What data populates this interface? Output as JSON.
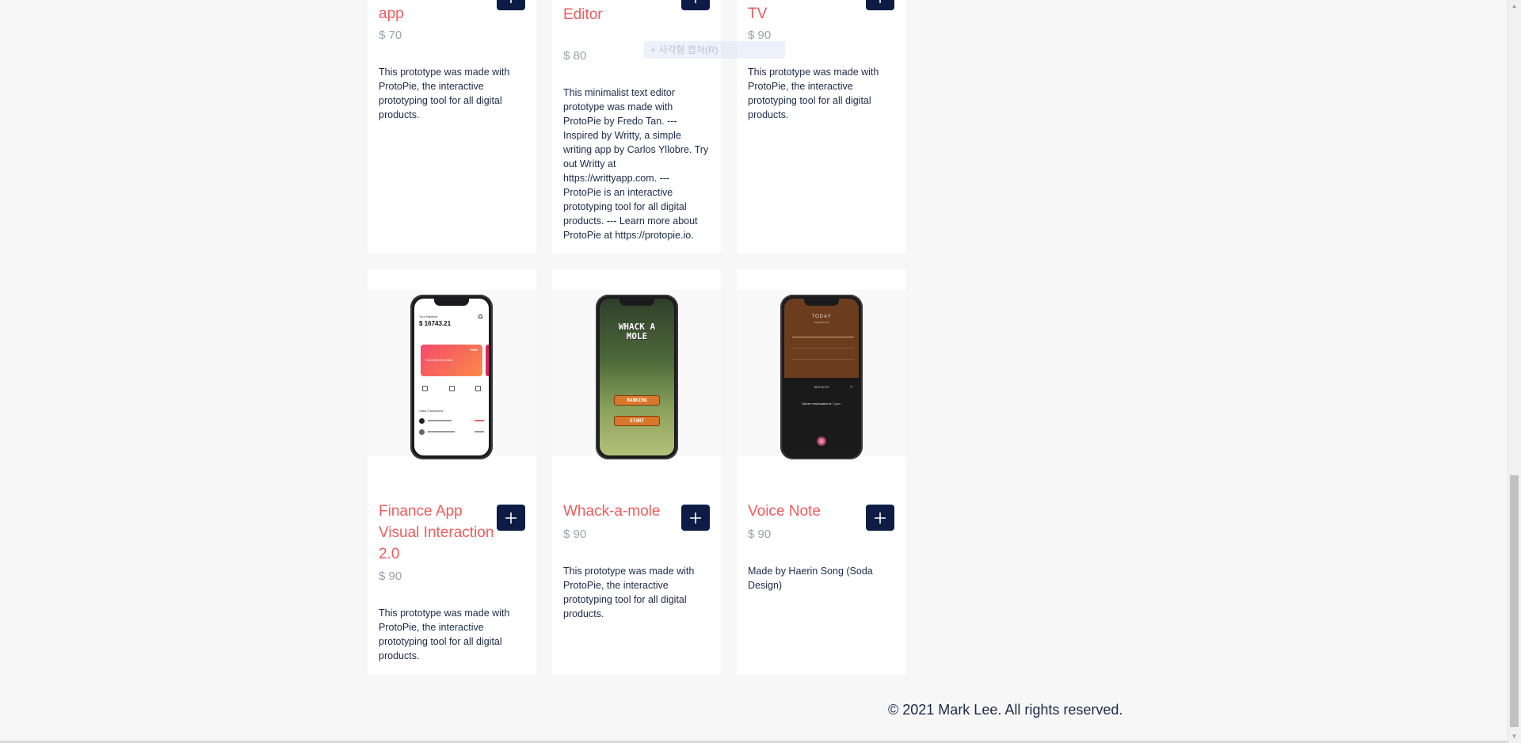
{
  "top_cards": [
    {
      "title": "app",
      "price": "$ 70",
      "description": "This prototype was made with ProtoPie, the interactive prototyping tool for all digital products."
    },
    {
      "title": "Minimalist Text Editor",
      "price": "$ 80",
      "description": "This minimalist text editor prototype was made with ProtoPie by Fredo Tan. --- Inspired by Writty, a simple writing app by Carlos Yllobre. Try out Writty at https://writtyapp.com. --- ProtoPie is an interactive prototyping tool for all digital products. --- Learn more about ProtoPie at https://protopie.io."
    },
    {
      "title": "TV",
      "price": "$ 90",
      "description": "This prototype was made with ProtoPie, the interactive prototyping tool for all digital products."
    }
  ],
  "bottom_cards": [
    {
      "title": "Finance App Visual Interaction 2.0",
      "price": "$ 90",
      "description": "This prototype was made with ProtoPie, the interactive prototyping tool for all digital products.",
      "screen": {
        "balance_label": "Your Balance",
        "balance": "$ 16743.21",
        "card_number": "1234 5678 9012 3456",
        "card_brand": "VISA",
        "section": "Latest Transactions"
      }
    },
    {
      "title": "Whack-a-mole",
      "price": "$ 90",
      "description": "This prototype was made with ProtoPie, the interactive prototyping tool for all digital products.",
      "screen": {
        "logo_line1": "WHACK A",
        "logo_line2": "MOLE",
        "btn1": "RANKING",
        "btn2": "START"
      }
    },
    {
      "title": "Voice Note",
      "price": "$ 90",
      "description": "Made by Haerin Song (Soda Design)",
      "screen": {
        "heading": "TODAY",
        "sub": "September 15",
        "note_label": "NEW NOTE",
        "note_text": "Dinner reservation at 7 p.m."
      }
    }
  ],
  "overlay_text": "+ 사각형 캡처(R)",
  "footer": "© 2021 Mark Lee. All rights reserved.",
  "colors": {
    "title": "#ef5b5b",
    "button": "#0d1c45",
    "price": "#9aa2ad",
    "text": "#1b2a48"
  }
}
